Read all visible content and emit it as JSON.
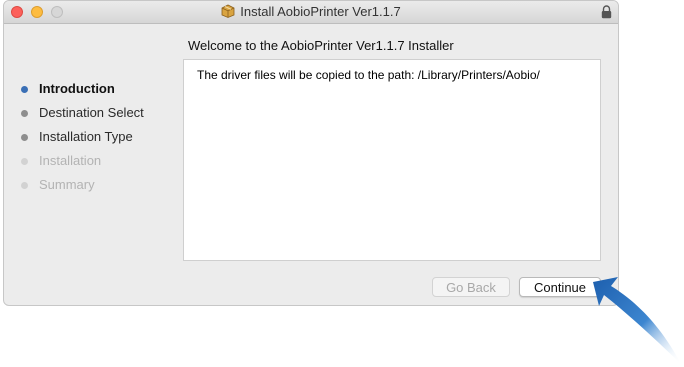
{
  "window": {
    "title": "Install AobioPrinter Ver1.1.7",
    "title_icon": "package-icon",
    "lock_icon": "lock-icon"
  },
  "heading": "Welcome to the AobioPrinter Ver1.1.7 Installer",
  "content": {
    "text": "The driver files will be copied to the path: /Library/Printers/Aobio/"
  },
  "sidebar": {
    "steps": [
      {
        "label": "Introduction",
        "state": "active"
      },
      {
        "label": "Destination Select",
        "state": "pending"
      },
      {
        "label": "Installation Type",
        "state": "pending"
      },
      {
        "label": "Installation",
        "state": "disabled"
      },
      {
        "label": "Summary",
        "state": "disabled"
      }
    ]
  },
  "buttons": {
    "go_back": "Go Back",
    "continue": "Continue"
  },
  "colors": {
    "active_dot": "#3a6fb5",
    "arrow": "#2a6db5"
  }
}
